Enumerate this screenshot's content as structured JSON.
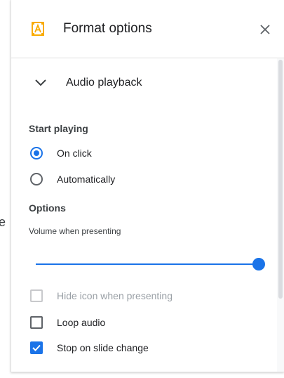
{
  "left_fragment": {
    "text": "e"
  },
  "header": {
    "title": "Format options",
    "icon": "format-options-icon",
    "close_icon": "close-icon"
  },
  "section": {
    "label": "Audio playback",
    "expanded": true,
    "icon": "chevron-down-icon"
  },
  "start_playing": {
    "label": "Start playing",
    "options": [
      {
        "label": "On click",
        "selected": true
      },
      {
        "label": "Automatically",
        "selected": false
      }
    ]
  },
  "options": {
    "label": "Options",
    "volume_label": "Volume when presenting",
    "volume_fraction": 1.0,
    "checkboxes": [
      {
        "label": "Hide icon when presenting",
        "checked": false,
        "disabled": true
      },
      {
        "label": "Loop audio",
        "checked": false,
        "disabled": false
      },
      {
        "label": "Stop on slide change",
        "checked": true,
        "disabled": false
      }
    ]
  },
  "colors": {
    "accent": "#1a73e8",
    "icon_orange": "#f9ab00",
    "text": "#202124",
    "disabled_text": "#9aa0a6"
  }
}
